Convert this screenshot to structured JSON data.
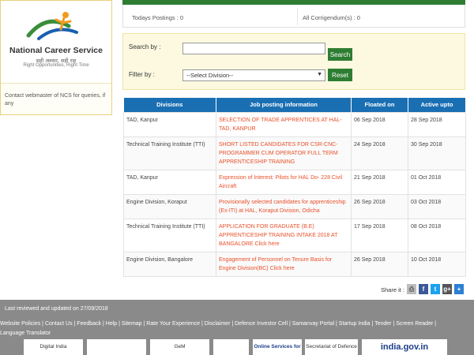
{
  "sidebar": {
    "logo_title": "National Career Service",
    "logo_hindi": "सही अवसर, सही राह",
    "logo_tagline": "Right Opportunities, Right Time",
    "contact_text": "Contact webmaster of NCS for queries, if any"
  },
  "stats": {
    "todays_postings_label": "Todays Postings :",
    "todays_postings_value": "0",
    "all_corrigendum_label": "All Corrigendum(s) :",
    "all_corrigendum_value": "0"
  },
  "search": {
    "search_label": "Search by :",
    "search_value": "",
    "search_button": "Search",
    "filter_label": "Filter by :",
    "filter_selected": "--Select Division--",
    "reset_button": "Reset"
  },
  "table": {
    "headers": [
      "Divisions",
      "Job posting information",
      "Floated on",
      "Active upto"
    ],
    "rows": [
      {
        "division": "TAD, Kanpur",
        "info": "SELECTION OF TRADE APPRENTICES AT HAL-TAD, KANPUR",
        "floated": "06 Sep 2018",
        "active": "28 Sep 2018"
      },
      {
        "division": "Technical Training Institute (TTI)",
        "info": "SHORT LISTED CANDIDATES FOR CSR-CNC-PROGRAMMER CUM OPERATOR FULL TERM APPRENTICESHIP TRAINING",
        "floated": "24 Sep 2018",
        "active": "30 Sep 2018"
      },
      {
        "division": "TAD, Kanpur",
        "info": "Expression of Interest: Pilots for HAL Do- 228 Civil Aircraft",
        "floated": "21 Sep 2018",
        "active": "01 Oct 2018"
      },
      {
        "division": "Engine Division, Koraput",
        "info": "Provisionally selected candidates for apprenticeship (Ex-ITI) at HAL, Koraput Division, Odicha",
        "floated": "26 Sep 2018",
        "active": "03 Oct 2018"
      },
      {
        "division": "Technical Training Institute (TTI)",
        "info": "APPLICATION FOR GRADUATE (B.E) APPRENTICESHIP TRAINING INTAKE 2018 AT BANGALORE Click here",
        "floated": "17 Sep 2018",
        "active": "08 Oct 2018"
      },
      {
        "division": "Engine Division, Bangalore",
        "info": "Engagement of Personnel on Tenure Basis for Engine Division(BC) Click here",
        "floated": "26 Sep 2018",
        "active": "10 Oct 2018"
      }
    ]
  },
  "share": {
    "label": "Share it :"
  },
  "footer": {
    "updated": "Last reviewed and updated on 27/09/2018",
    "links": [
      "Website Policies",
      "Contact Us",
      "Feedback",
      "Help",
      "Sitemap",
      "Rate Your Experience",
      "Disclaimer",
      "Defence Investor Cell",
      "Samanvay Portal",
      "Startup India",
      "Tender",
      "Screen Reader",
      "Language Translator"
    ],
    "banners": [
      "Digital India",
      "",
      "GeM",
      "",
      "Online Services for VOTERS",
      "Secretariat of Defence",
      "india.gov.in"
    ]
  },
  "colors": {
    "accent_green": "#2e7d32",
    "table_header_blue": "#1a6fb3",
    "link_orange": "#e8502a"
  }
}
